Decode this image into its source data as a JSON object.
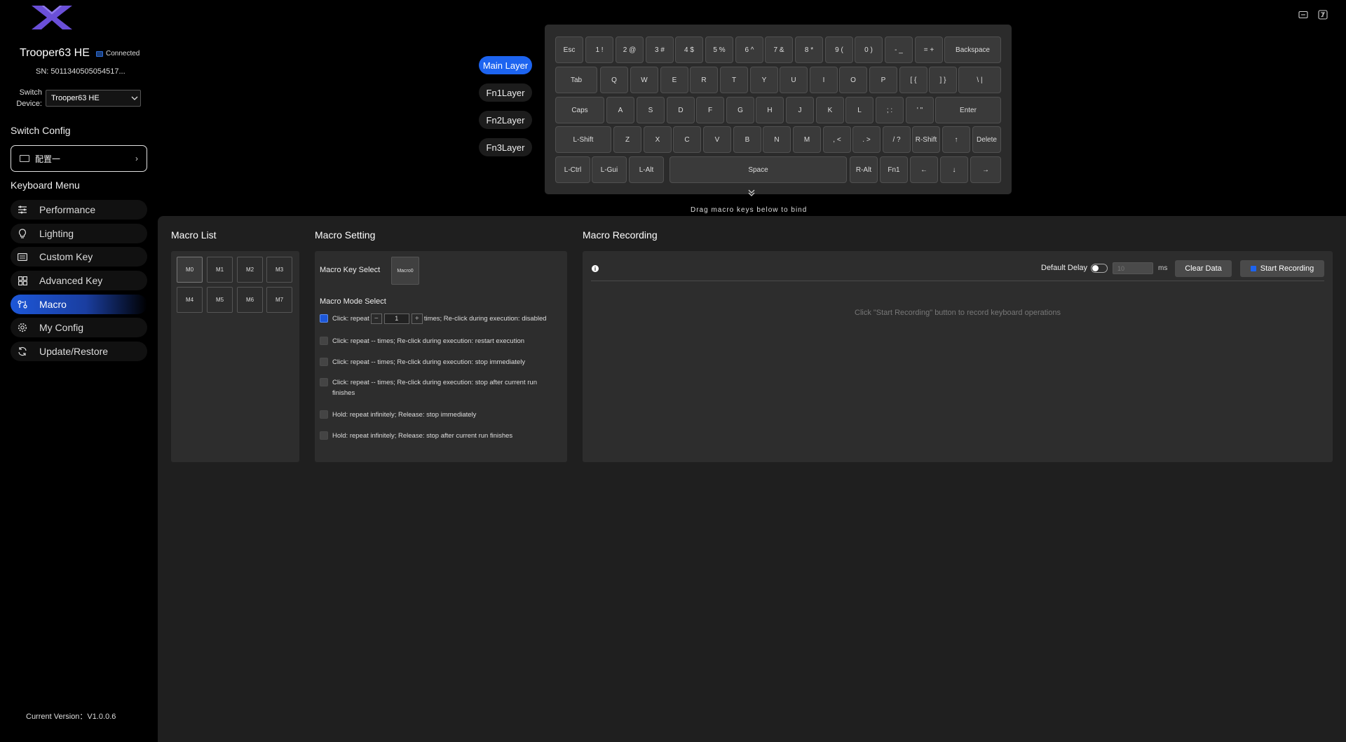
{
  "device": {
    "name": "Trooper63 HE",
    "status": "Connected",
    "serial": "SN: 5011340505054517...",
    "switch_device_label": "Switch Device:",
    "selected_device": "Trooper63 HE"
  },
  "config": {
    "title": "Switch Config",
    "current": "配置一"
  },
  "menu": {
    "title": "Keyboard Menu",
    "items": [
      {
        "label": "Performance",
        "icon": "sliders-icon"
      },
      {
        "label": "Lighting",
        "icon": "bulb-icon"
      },
      {
        "label": "Custom Key",
        "icon": "keyboard-icon"
      },
      {
        "label": "Advanced Key",
        "icon": "grid-icon"
      },
      {
        "label": "Macro",
        "icon": "macro-icon",
        "active": true
      },
      {
        "label": "My Config",
        "icon": "gear-icon"
      },
      {
        "label": "Update/Restore",
        "icon": "refresh-icon"
      }
    ]
  },
  "version": "Current Version：V1.0.0.6",
  "layers": [
    "Main Layer",
    "Fn1Layer",
    "Fn2Layer",
    "Fn3Layer"
  ],
  "keyboard": {
    "rows": [
      [
        "Esc",
        "1 !",
        "2 @",
        "3 #",
        "4 $",
        "5 %",
        "6 ^",
        "7 &",
        "8 *",
        "9 (",
        "0 )",
        "- _",
        "= +",
        "Backspace"
      ],
      [
        "Tab",
        "Q",
        "W",
        "E",
        "R",
        "T",
        "Y",
        "U",
        "I",
        "O",
        "P",
        "[ {",
        "] }",
        "\\ |"
      ],
      [
        "Caps",
        "A",
        "S",
        "D",
        "F",
        "G",
        "H",
        "J",
        "K",
        "L",
        "; :",
        "' \"",
        "Enter"
      ],
      [
        "L-Shift",
        "Z",
        "X",
        "C",
        "V",
        "B",
        "N",
        "M",
        ", <",
        ". >",
        "/ ?",
        "R-Shift",
        "↑",
        "Delete"
      ],
      [
        "L-Ctrl",
        "L-Gui",
        "L-Alt",
        "Space",
        "R-Alt",
        "Fn1",
        "←",
        "↓",
        "→"
      ]
    ]
  },
  "drag_hint": "Drag macro keys below to bind",
  "macro_list": {
    "title": "Macro List",
    "items": [
      "M0",
      "M1",
      "M2",
      "M3",
      "M4",
      "M5",
      "M6",
      "M7"
    ]
  },
  "macro_setting": {
    "title": "Macro Setting",
    "key_select_label": "Macro Key Select",
    "key_select_value": "Macro0",
    "mode_select_label": "Macro Mode Select",
    "repeat_count": "1",
    "modes": [
      {
        "before": "Click: repeat",
        "after": "times; Re-click during execution: disabled",
        "checked": true
      },
      {
        "text": "Click: repeat -- times; Re-click during execution: restart execution"
      },
      {
        "text": "Click: repeat -- times; Re-click during execution: stop immediately"
      },
      {
        "text": "Click: repeat -- times; Re-click during execution: stop after current run finishes"
      },
      {
        "text": "Hold: repeat infinitely; Release: stop immediately"
      },
      {
        "text": "Hold: repeat infinitely; Release: stop after current run finishes"
      }
    ]
  },
  "macro_recording": {
    "title": "Macro Recording",
    "default_delay_label": "Default Delay",
    "delay_value": "10",
    "delay_unit": "ms",
    "clear_label": "Clear Data",
    "record_label": "Start Recording",
    "empty_hint": "Click \"Start Recording\" button to record keyboard operations"
  },
  "colors": {
    "accent": "#1d64f0",
    "background": "#000000",
    "panel": "#1f1f1f"
  }
}
